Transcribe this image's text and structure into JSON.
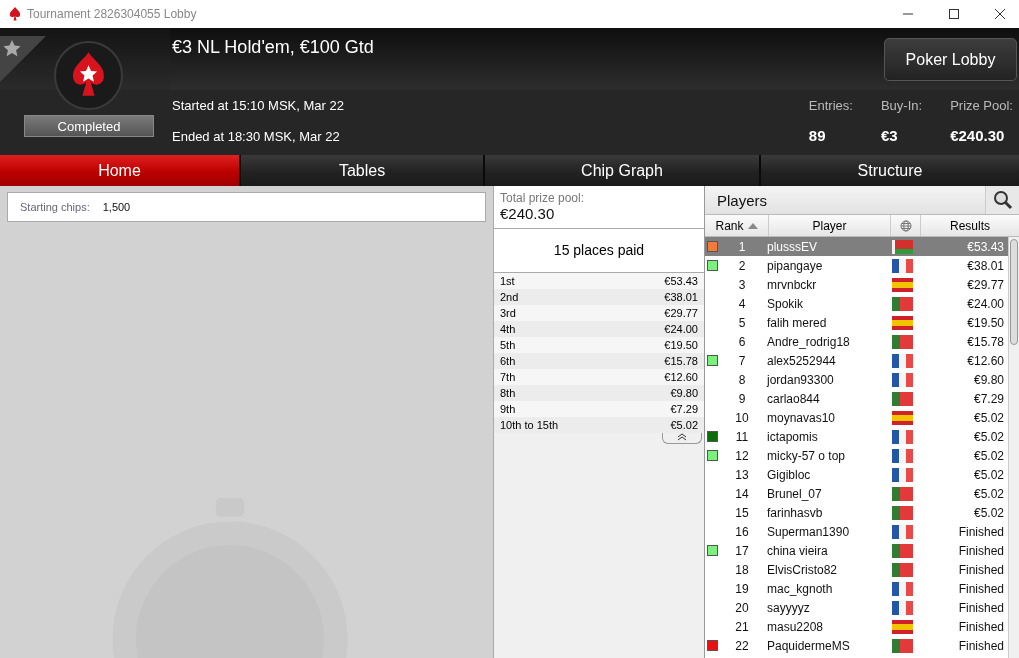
{
  "window": {
    "title": "Tournament 2826304055 Lobby"
  },
  "header": {
    "name": "€3 NL Hold'em, €100 Gtd",
    "status": "Completed",
    "started": "Started at 15:10 MSK, Mar 22",
    "ended": "Ended at 18:30 MSK, Mar 22",
    "lobby_button": "Poker Lobby",
    "stats": [
      {
        "label": "Entries:",
        "value": "89"
      },
      {
        "label": "Buy-In:",
        "value": "€3"
      },
      {
        "label": "Prize Pool:",
        "value": "€240.30"
      }
    ]
  },
  "tabs": [
    {
      "label": "Home",
      "selected": true
    },
    {
      "label": "Tables",
      "selected": false
    },
    {
      "label": "Chip Graph",
      "selected": false
    },
    {
      "label": "Structure",
      "selected": false
    }
  ],
  "info": {
    "label": "Starting chips:",
    "value": "1,500"
  },
  "prizes": {
    "total_label": "Total prize pool:",
    "total": "€240.30",
    "places": "15 places paid",
    "rows": [
      {
        "place": "1st",
        "amount": "€53.43"
      },
      {
        "place": "2nd",
        "amount": "€38.01"
      },
      {
        "place": "3rd",
        "amount": "€29.77"
      },
      {
        "place": "4th",
        "amount": "€24.00"
      },
      {
        "place": "5th",
        "amount": "€19.50"
      },
      {
        "place": "6th",
        "amount": "€15.78"
      },
      {
        "place": "7th",
        "amount": "€12.60"
      },
      {
        "place": "8th",
        "amount": "€9.80"
      },
      {
        "place": "9th",
        "amount": "€7.29"
      },
      {
        "place": "10th to 15th",
        "amount": "€5.02"
      }
    ]
  },
  "players": {
    "title": "Players",
    "columns": [
      "Rank",
      "Player",
      "Results"
    ],
    "rows": [
      {
        "rank": "1",
        "name": "plusssEV",
        "kind": "by",
        "result": "€53.43",
        "color": "#f47a3c",
        "selected": true
      },
      {
        "rank": "2",
        "name": "pipangaye",
        "kind": "fr",
        "result": "€38.01",
        "color": "#7cf07c",
        "selected": false
      },
      {
        "rank": "3",
        "name": "mrvnbckr",
        "kind": "es",
        "result": "€29.77",
        "selected": false
      },
      {
        "rank": "4",
        "name": "Spokik",
        "kind": "pt",
        "result": "€24.00",
        "selected": false
      },
      {
        "rank": "5",
        "name": "falih mered",
        "kind": "es",
        "result": "€19.50",
        "selected": false
      },
      {
        "rank": "6",
        "name": "Andre_rodrig18",
        "kind": "pt",
        "result": "€15.78",
        "selected": false
      },
      {
        "rank": "7",
        "name": "alex5252944",
        "kind": "fr",
        "result": "€12.60",
        "color": "#7cf07c",
        "selected": false
      },
      {
        "rank": "8",
        "name": "jordan93300",
        "kind": "fr",
        "result": "€9.80",
        "selected": false
      },
      {
        "rank": "9",
        "name": "carlao844",
        "kind": "pt",
        "result": "€7.29",
        "selected": false
      },
      {
        "rank": "10",
        "name": "moynavas10",
        "kind": "es",
        "result": "€5.02",
        "selected": false
      },
      {
        "rank": "11",
        "name": "ictapomis",
        "kind": "fr",
        "result": "€5.02",
        "color": "#0a6e0a",
        "selected": false
      },
      {
        "rank": "12",
        "name": "micky-57 o top",
        "kind": "fr",
        "result": "€5.02",
        "color": "#7cf07c",
        "selected": false
      },
      {
        "rank": "13",
        "name": "Gigibloc",
        "kind": "fr",
        "result": "€5.02",
        "selected": false
      },
      {
        "rank": "14",
        "name": "Brunel_07",
        "kind": "pt",
        "result": "€5.02",
        "selected": false
      },
      {
        "rank": "15",
        "name": "farinhasvb",
        "kind": "pt",
        "result": "€5.02",
        "selected": false
      },
      {
        "rank": "16",
        "name": "Superman1390",
        "kind": "fr",
        "result": "Finished",
        "selected": false
      },
      {
        "rank": "17",
        "name": "china vieira",
        "kind": "pt",
        "result": "Finished",
        "color": "#7cf07c",
        "selected": false
      },
      {
        "rank": "18",
        "name": "ElvisCristo82",
        "kind": "pt",
        "result": "Finished",
        "selected": false
      },
      {
        "rank": "19",
        "name": "mac_kgnoth",
        "kind": "fr",
        "result": "Finished",
        "selected": false
      },
      {
        "rank": "20",
        "name": "sayyyyz",
        "kind": "fr",
        "result": "Finished",
        "selected": false
      },
      {
        "rank": "21",
        "name": "masu2208",
        "kind": "es",
        "result": "Finished",
        "selected": false
      },
      {
        "rank": "22",
        "name": "PaquidermeMS",
        "kind": "pt",
        "result": "Finished",
        "color": "#e81010",
        "selected": false
      }
    ]
  }
}
